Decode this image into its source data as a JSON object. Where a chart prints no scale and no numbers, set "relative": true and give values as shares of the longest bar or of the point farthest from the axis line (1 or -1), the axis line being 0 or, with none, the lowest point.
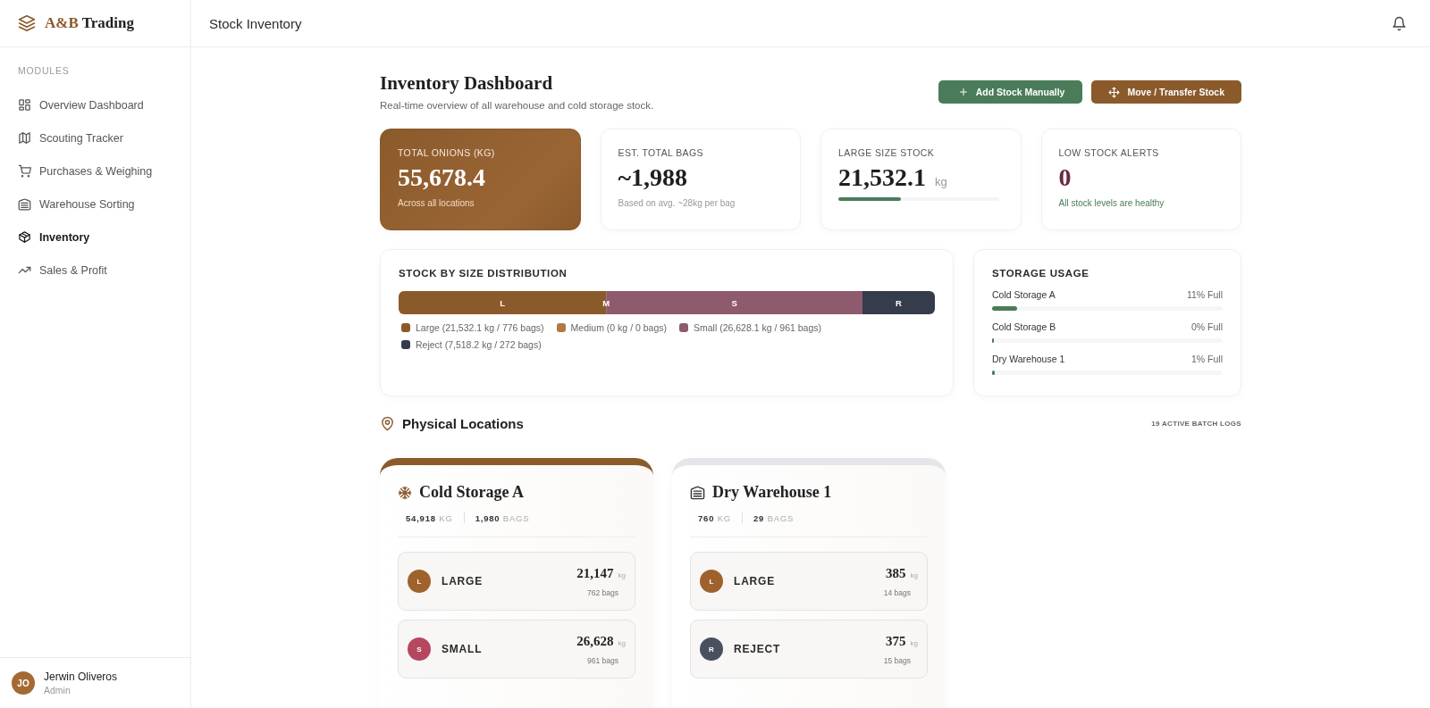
{
  "brand": {
    "name_part_1": "A&B",
    "name_part_2": "Trading"
  },
  "header": {
    "title": "Stock Inventory"
  },
  "sidebar": {
    "section_label": "MODULES",
    "items": [
      {
        "label": "Overview Dashboard",
        "selected": false
      },
      {
        "label": "Scouting Tracker",
        "selected": false
      },
      {
        "label": "Purchases & Weighing",
        "selected": false
      },
      {
        "label": "Warehouse Sorting",
        "selected": false
      },
      {
        "label": "Inventory",
        "selected": true
      },
      {
        "label": "Sales & Profit",
        "selected": false
      }
    ],
    "user": {
      "initials": "JO",
      "name": "Jerwin Oliveros",
      "role": "Admin"
    }
  },
  "page": {
    "title": "Inventory Dashboard",
    "subtitle": "Real-time overview of all warehouse and cold storage stock.",
    "buttons": [
      {
        "label": "Add Stock Manually",
        "kind": "add"
      },
      {
        "label": "Move / Transfer Stock",
        "kind": "move"
      }
    ]
  },
  "stats": [
    {
      "kind": "highlight",
      "label": "TOTAL ONIONS (KG)",
      "value": "55,678.4",
      "note": "Across all locations"
    },
    {
      "kind": "plain",
      "label": "EST. TOTAL BAGS",
      "value": "~1,988",
      "note": "Based on avg. ~28kg per bag"
    },
    {
      "kind": "meter",
      "label": "LARGE SIZE STOCK",
      "value": "21,532.1",
      "unit": "kg",
      "level": 0.39
    },
    {
      "kind": "alert",
      "label": "LOW STOCK ALERTS",
      "value": "0",
      "note": "All stock levels are healthy"
    }
  ],
  "distribution": {
    "title": "STOCK BY SIZE DISTRIBUTION",
    "bar_labels": [
      "L",
      "M",
      "S",
      "R"
    ],
    "chart_data": {
      "type": "bar",
      "orientation": "horizontal",
      "stacked": true,
      "relative": true,
      "series": [
        {
          "name": "Large (21,532.1 kg / 776 bags)",
          "color": "#8b5a2b",
          "values": [
            0.387
          ]
        },
        {
          "name": "Medium (0 kg / 0 bags)",
          "color": "#b07a45",
          "values": [
            0
          ]
        },
        {
          "name": "Small (26,628.1 kg / 961 bags)",
          "color": "#8e5a6e",
          "values": [
            0.478
          ]
        },
        {
          "name": "Reject (7,518.2 kg / 272 bags)",
          "color": "#353c4c",
          "values": [
            0.135
          ]
        }
      ]
    }
  },
  "storage_usage": {
    "title": "STORAGE USAGE",
    "items": [
      {
        "name": "Cold Storage A",
        "reading": "11% Full",
        "level": 0.11
      },
      {
        "name": "Cold Storage B",
        "reading": "0% Full",
        "level": 0
      },
      {
        "name": "Dry Warehouse 1",
        "reading": "1% Full",
        "level": 0.01
      }
    ]
  },
  "locations": {
    "title": "Physical Locations",
    "count": "19 ACTIVE BATCH LOGS",
    "cards": [
      {
        "name": "Cold Storage A",
        "kind": "cold",
        "color": "#8b5a2b",
        "kg": "54,918",
        "kg_unit": "KG",
        "bags": "1,980",
        "bags_unit": "BAGS",
        "items": [
          {
            "initial": "L",
            "label": "LARGE",
            "kg": "21,147",
            "unit": "kg",
            "bags": "762 bags",
            "color": "#a0622d"
          },
          {
            "initial": "S",
            "label": "SMALL",
            "kg": "26,628",
            "unit": "kg",
            "bags": "961 bags",
            "color": "#b5475e"
          }
        ]
      },
      {
        "name": "Dry Warehouse 1",
        "kind": "warehouse",
        "color": "#e5e6ea",
        "kg": "760",
        "kg_unit": "KG",
        "bags": "29",
        "bags_unit": "BAGS",
        "items": [
          {
            "initial": "L",
            "label": "LARGE",
            "kg": "385",
            "unit": "kg",
            "bags": "14 bags",
            "color": "#a0622d"
          },
          {
            "initial": "R",
            "label": "REJECT",
            "kg": "375",
            "unit": "kg",
            "bags": "15 bags",
            "color": "#4a5060"
          }
        ]
      }
    ]
  }
}
